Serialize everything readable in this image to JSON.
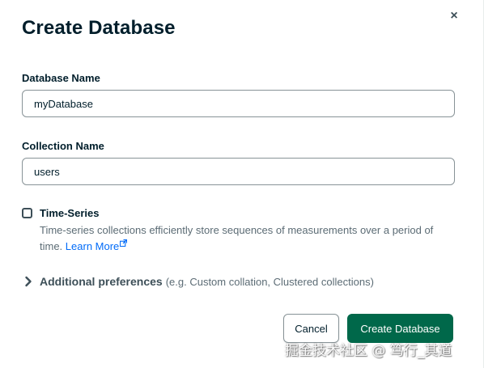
{
  "dialog": {
    "title": "Create Database",
    "close_icon": "close-icon",
    "close_glyph": "×"
  },
  "database_name": {
    "label": "Database Name",
    "value": "myDatabase"
  },
  "collection_name": {
    "label": "Collection Name",
    "value": "users"
  },
  "time_series": {
    "label": "Time-Series",
    "checked": false,
    "description": "Time-series collections efficiently store sequences of measurements over a period of time.",
    "learn_more": "Learn More",
    "link_icon": "external-link-icon"
  },
  "additional_preferences": {
    "label": "Additional preferences",
    "hint": "(e.g. Custom collation, Clustered collections)",
    "icon": "chevron-right-icon"
  },
  "actions": {
    "cancel": "Cancel",
    "create": "Create Database"
  },
  "watermark": "掘金技术社区 @ 笃行_其道",
  "colors": {
    "primary_button": "#00684A",
    "link": "#016BF8",
    "text": "#001E2B",
    "muted_text": "#5C6C75",
    "border": "#889397"
  }
}
